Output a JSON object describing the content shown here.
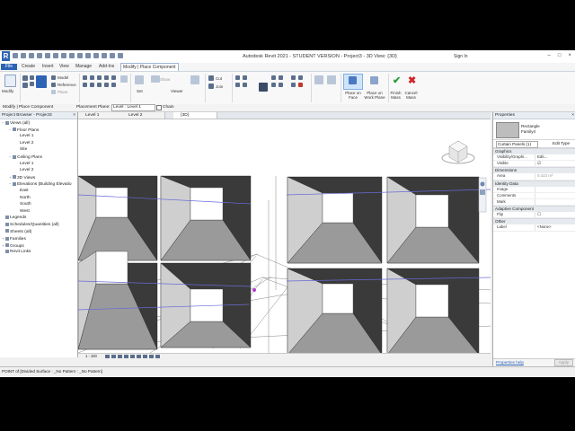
{
  "title_bar": {
    "logo": "R",
    "title": "Autodesk Revit 2021 - STUDENT VERSION - Project3 - 3D View: {3D}",
    "sign_in": "Sign In",
    "window_buttons": [
      "–",
      "□",
      "×"
    ]
  },
  "menu": {
    "tabs": [
      "File",
      "Create",
      "Insert",
      "View",
      "Manage",
      "Add-Ins",
      "Modify | Place Component"
    ]
  },
  "ribbon": {
    "modify_label": "Modify",
    "properties_group": [
      "Model",
      "Reference",
      "Plane"
    ],
    "cut_labels": [
      "Cut",
      "Join"
    ],
    "set_label": "Set",
    "show_label": "Show",
    "viewer_label": "Viewer",
    "place_on_face": "Place on Face",
    "place_on_work_plane": "Place on Work Plane",
    "finish_mass": "Finish Mass",
    "cancel_mass": "Cancel Mass"
  },
  "options_bar": {
    "context": "Modify | Place Component",
    "placement_plane_label": "Placement Plane:",
    "placement_plane_value": "Level : Level 1",
    "chain_label": "Chain"
  },
  "project_browser": {
    "title": "Project Browser - Project3",
    "rows": [
      {
        "label": "Views (all)",
        "toggle": "−",
        "indent": 0
      },
      {
        "label": "Floor Plans",
        "toggle": "−",
        "indent": 1
      },
      {
        "label": "Level 1",
        "toggle": "",
        "indent": 2
      },
      {
        "label": "Level 2",
        "toggle": "",
        "indent": 2
      },
      {
        "label": "Site",
        "toggle": "",
        "indent": 2
      },
      {
        "label": "Ceiling Plans",
        "toggle": "−",
        "indent": 1
      },
      {
        "label": "Level 1",
        "toggle": "",
        "indent": 2
      },
      {
        "label": "Level 2",
        "toggle": "",
        "indent": 2
      },
      {
        "label": "3D Views",
        "toggle": "+",
        "indent": 1
      },
      {
        "label": "Elevations (Building Elevatio",
        "toggle": "−",
        "indent": 1
      },
      {
        "label": "East",
        "toggle": "",
        "indent": 2
      },
      {
        "label": "North",
        "toggle": "",
        "indent": 2
      },
      {
        "label": "South",
        "toggle": "",
        "indent": 2
      },
      {
        "label": "West",
        "toggle": "",
        "indent": 2
      },
      {
        "label": "Legends",
        "toggle": "",
        "indent": 0
      },
      {
        "label": "Schedules/Quantities (all)",
        "toggle": "",
        "indent": 0
      },
      {
        "label": "Sheets (all)",
        "toggle": "",
        "indent": 0
      },
      {
        "label": "Families",
        "toggle": "+",
        "indent": 0
      },
      {
        "label": "Groups",
        "toggle": "+",
        "indent": 0
      },
      {
        "label": "Revit Links",
        "toggle": "",
        "indent": 0
      }
    ]
  },
  "view_tabs": [
    {
      "label": "Level 1",
      "active": false
    },
    {
      "label": "Level 2",
      "active": false
    },
    {
      "label": "{3D}",
      "active": true
    }
  ],
  "view_bar": {
    "scale": "1 : 100"
  },
  "properties": {
    "title": "Properties",
    "family_name": "Rectangle",
    "family_type": "Family4",
    "selector": "Curtain Panels (1)",
    "edit_type": "Edit Type",
    "sections": [
      {
        "name": "Graphics",
        "rows": [
          {
            "key": "Visibility/Graphi...",
            "value": "Edit..."
          },
          {
            "key": "Visible",
            "value": "☑"
          }
        ]
      },
      {
        "name": "Dimensions",
        "rows": [
          {
            "key": "Area",
            "value": "0.423 m²"
          }
        ]
      },
      {
        "name": "Identity Data",
        "rows": [
          {
            "key": "Image",
            "value": ""
          },
          {
            "key": "Comments",
            "value": ""
          },
          {
            "key": "Mark",
            "value": ""
          }
        ]
      },
      {
        "name": "Adaptive Component",
        "rows": [
          {
            "key": "Flip",
            "value": "☐"
          }
        ]
      },
      {
        "name": "Other",
        "rows": [
          {
            "key": "Label",
            "value": "<None>"
          }
        ]
      }
    ],
    "help_link": "Properties help",
    "apply": "Apply"
  },
  "status_bar": {
    "text": "POINT of [Divided Surface : _No Pattern : _No Pattern]"
  },
  "colors": {
    "accent": "#2d63b5",
    "panel_dark": "#3a3a3a",
    "panel_mid": "#9a9a9a",
    "panel_light": "#cfcfcf",
    "grid_line": "#6a6ad8"
  }
}
